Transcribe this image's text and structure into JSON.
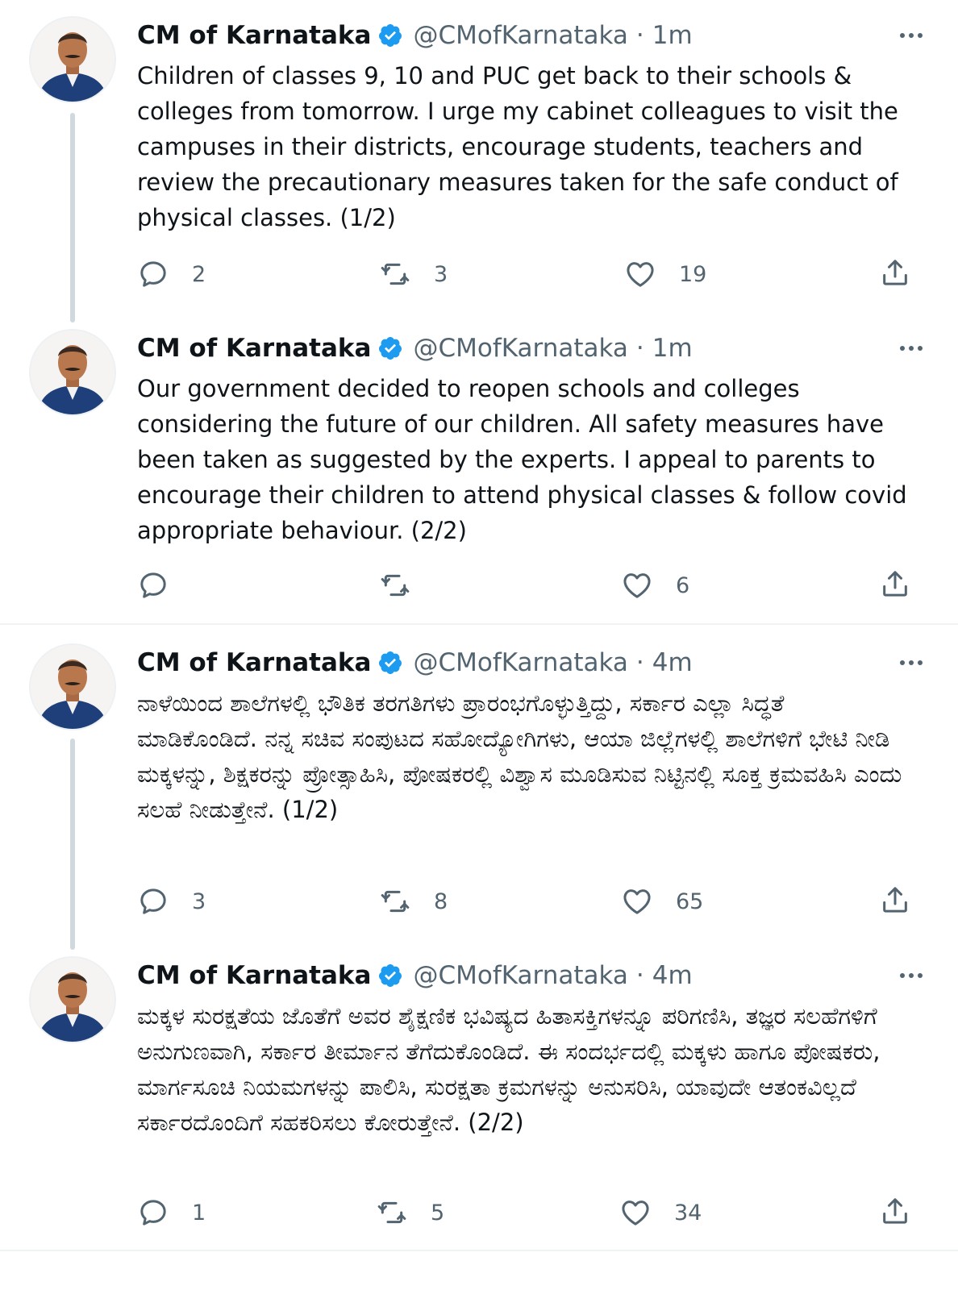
{
  "colors": {
    "verified": "#1d9bf0",
    "text": "#0f1419",
    "secondary": "#536471",
    "thread_line": "#cfd9de"
  },
  "tweets": [
    {
      "name": "CM of Karnataka",
      "handle": "@CMofKarnataka",
      "separator": "·",
      "time": "1m",
      "text": "Children of classes 9, 10 and PUC get back to their schools & colleges from tomorrow. I urge my cabinet colleagues to visit the campuses in their districts, encourage students, teachers and review the precautionary measures taken for the safe conduct of physical classes. (1/2)",
      "replies": "2",
      "retweets": "3",
      "likes": "19",
      "icons": [
        "verified-badge-icon",
        "more-icon",
        "reply-icon",
        "retweet-icon",
        "like-icon",
        "share-icon"
      ]
    },
    {
      "name": "CM of Karnataka",
      "handle": "@CMofKarnataka",
      "separator": "·",
      "time": "1m",
      "text": "Our government decided to reopen schools and colleges considering the future of our children. All safety measures have been taken as suggested by the experts. I appeal to parents to encourage their children to attend physical classes & follow covid appropriate behaviour. (2/2)",
      "replies": "",
      "retweets": "",
      "likes": "6"
    },
    {
      "name": "CM of Karnataka",
      "handle": "@CMofKarnataka",
      "separator": "·",
      "time": "4m",
      "text": "ನಾಳೆಯಿಂದ ಶಾಲೆಗಳಲ್ಲಿ ಭೌತಿಕ ತರಗತಿಗಳು  ಪ್ರಾರಂಭಗೊಳ್ಳುತ್ತಿದ್ದು, ಸರ್ಕಾರ ಎಲ್ಲಾ ಸಿದ್ಧತೆ ಮಾಡಿಕೊಂಡಿದೆ. ನನ್ನ ಸಚಿವ ಸಂಪುಟದ ಸಹೋದ್ಯೋಗಿಗಳು, ಆಯಾ ಜಿಲ್ಲೆಗಳಲ್ಲಿ ಶಾಲೆಗಳಿಗೆ ಭೇಟಿ ನೀಡಿ ಮಕ್ಕಳನ್ನು, ಶಿಕ್ಷಕರನ್ನು ಪ್ರೋತ್ಸಾಹಿಸಿ, ಪೋಷಕರಲ್ಲಿ ವಿಶ್ವಾಸ ಮೂಡಿಸುವ ನಿಟ್ಟಿನಲ್ಲಿ ಸೂಕ್ತ ಕ್ರಮವಹಿಸಿ ಎಂದು ಸಲಹೆ ನೀಡುತ್ತೇನೆ. (1/2)",
      "replies": "3",
      "retweets": "8",
      "likes": "65"
    },
    {
      "name": "CM of Karnataka",
      "handle": "@CMofKarnataka",
      "separator": "·",
      "time": "4m",
      "text": "ಮಕ್ಕಳ ಸುರಕ್ಷತೆಯ ಜೊತೆಗೆ ಅವರ ಶೈಕ್ಷಣಿಕ ಭವಿಷ್ಯದ ಹಿತಾಸಕ್ತಿಗಳನ್ನೂ ಪರಿಗಣಿಸಿ, ತಜ್ಞರ ಸಲಹೆಗಳಿಗೆ ಅನುಗುಣವಾಗಿ, ಸರ್ಕಾರ ತೀರ್ಮಾನ ತೆಗೆದುಕೊಂಡಿದೆ. ಈ ಸಂದರ್ಭದಲ್ಲಿ ಮಕ್ಕಳು ಹಾಗೂ ಪೋಷಕರು, ಮಾರ್ಗಸೂಚಿ ನಿಯಮಗಳನ್ನು ಪಾಲಿಸಿ, ಸುರಕ್ಷತಾ ಕ್ರಮಗಳನ್ನು ಅನುಸರಿಸಿ, ಯಾವುದೇ ಆತಂಕವಿಲ್ಲದೆ ಸರ್ಕಾರದೊಂದಿಗೆ ಸಹಕರಿಸಲು ಕೋರುತ್ತೇನೆ. (2/2)",
      "replies": "1",
      "retweets": "5",
      "likes": "34"
    }
  ]
}
